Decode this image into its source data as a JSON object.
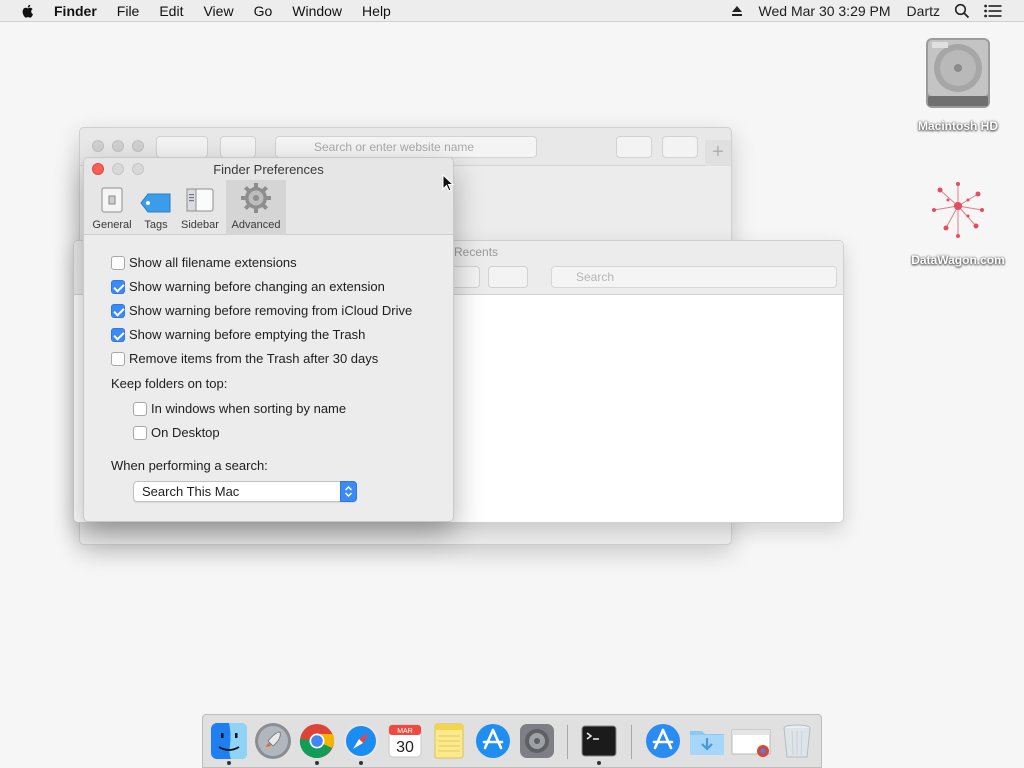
{
  "menubar": {
    "app_name": "Finder",
    "items": [
      "File",
      "Edit",
      "View",
      "Go",
      "Window",
      "Help"
    ],
    "clock": "Wed Mar 30  3:29 PM",
    "user": "Dartz"
  },
  "desktop": {
    "icons": [
      {
        "label": "Macintosh HD",
        "icon": "hard-drive-icon"
      },
      {
        "label": "DataWagon.com",
        "icon": "network-icon"
      }
    ]
  },
  "safari_window": {
    "url_placeholder": "Search or enter website name"
  },
  "finder_window": {
    "title": "Recents",
    "search_placeholder": "Search"
  },
  "prefs": {
    "title": "Finder Preferences",
    "tabs": [
      {
        "label": "General",
        "icon": "general-icon",
        "active": false
      },
      {
        "label": "Tags",
        "icon": "tag-icon",
        "active": false
      },
      {
        "label": "Sidebar",
        "icon": "sidebar-icon",
        "active": false
      },
      {
        "label": "Advanced",
        "icon": "gear-icon",
        "active": true
      }
    ],
    "options": [
      {
        "label": "Show all filename extensions",
        "checked": false
      },
      {
        "label": "Show warning before changing an extension",
        "checked": true
      },
      {
        "label": "Show warning before removing from iCloud Drive",
        "checked": true
      },
      {
        "label": "Show warning before emptying the Trash",
        "checked": true
      },
      {
        "label": "Remove items from the Trash after 30 days",
        "checked": false
      }
    ],
    "folders_heading": "Keep folders on top:",
    "folder_options": [
      {
        "label": "In windows when sorting by name",
        "checked": false
      },
      {
        "label": "On Desktop",
        "checked": false
      }
    ],
    "search_heading": "When performing a search:",
    "search_value": "Search This Mac"
  },
  "dock": {
    "calendar": {
      "month": "MAR",
      "day": "30"
    },
    "items": [
      "finder-icon",
      "launchpad-icon",
      "chrome-icon",
      "safari-icon",
      "calendar-icon",
      "notes-icon",
      "app-store-icon",
      "system-preferences-icon",
      "terminal-icon",
      "applications-folder-icon",
      "downloads-folder-icon",
      "browser-window-icon",
      "trash-icon"
    ]
  },
  "colors": {
    "accent": "#3b8bf6",
    "close_red": "#fc5f57"
  }
}
